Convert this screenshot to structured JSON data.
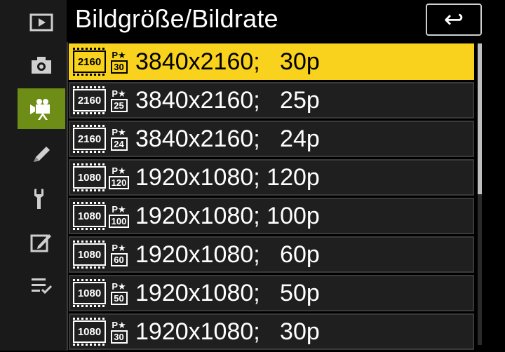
{
  "header": {
    "title": "Bildgröße/Bildrate",
    "back_icon": "↩"
  },
  "sidebar": {
    "items": [
      {
        "name": "playback-icon"
      },
      {
        "name": "camera-icon"
      },
      {
        "name": "movie-camera-icon",
        "active": true
      },
      {
        "name": "pencil-icon"
      },
      {
        "name": "wrench-icon"
      },
      {
        "name": "retouch-icon"
      },
      {
        "name": "my-menu-icon"
      }
    ]
  },
  "list": {
    "items": [
      {
        "size_badge": "2160",
        "rate_badge": "30",
        "pstar": "P★",
        "label": "3840x2160;   30p",
        "selected": true
      },
      {
        "size_badge": "2160",
        "rate_badge": "25",
        "pstar": "P★",
        "label": "3840x2160;   25p"
      },
      {
        "size_badge": "2160",
        "rate_badge": "24",
        "pstar": "P★",
        "label": "3840x2160;   24p"
      },
      {
        "size_badge": "1080",
        "rate_badge": "120",
        "pstar": "P★",
        "label": "1920x1080; 120p"
      },
      {
        "size_badge": "1080",
        "rate_badge": "100",
        "pstar": "P★",
        "label": "1920x1080; 100p"
      },
      {
        "size_badge": "1080",
        "rate_badge": "60",
        "pstar": "P★",
        "label": "1920x1080;   60p"
      },
      {
        "size_badge": "1080",
        "rate_badge": "50",
        "pstar": "P★",
        "label": "1920x1080;   50p"
      },
      {
        "size_badge": "1080",
        "rate_badge": "30",
        "pstar": "P★",
        "label": "1920x1080;   30p"
      }
    ]
  },
  "colors": {
    "selected_bg": "#f8d21c",
    "active_tab_bg": "#6e8d16",
    "row_bg": "#1f1f1f"
  },
  "scroll": {
    "position": 0.0,
    "visible_fraction": 0.5
  }
}
